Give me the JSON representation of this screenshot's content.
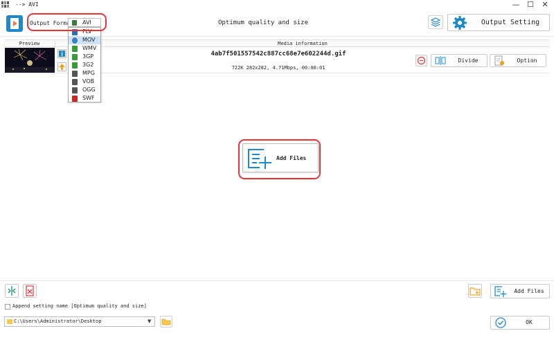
{
  "window": {
    "title": "--> AVI",
    "minimize": "—",
    "maximize": "☐",
    "close": "✕"
  },
  "toolbar": {
    "output_format_label": "Output Format",
    "selected_format": "AVI",
    "center_title": "Optimum quality and size",
    "output_setting_label": "Output Setting"
  },
  "format_dropdown": {
    "options": [
      {
        "label": "FLV",
        "icon": "flv-icon",
        "color": "#2b6fb3"
      },
      {
        "label": "MOV",
        "icon": "mov-icon",
        "color": "#3a7fc1"
      },
      {
        "label": "WMV",
        "icon": "wmv-icon",
        "color": "#3a9a3a"
      },
      {
        "label": "3GP",
        "icon": "3gp-icon",
        "color": "#3a9a3a"
      },
      {
        "label": "3G2",
        "icon": "3g2-icon",
        "color": "#3a9a3a"
      },
      {
        "label": "MPG",
        "icon": "mpg-icon",
        "color": "#555555"
      },
      {
        "label": "VOB",
        "icon": "vob-icon",
        "color": "#555555"
      },
      {
        "label": "OGG",
        "icon": "ogg-icon",
        "color": "#555555"
      },
      {
        "label": "SWF",
        "icon": "swf-icon",
        "color": "#c62828"
      }
    ],
    "highlighted": "MOV"
  },
  "list": {
    "col_preview": "Preview",
    "col_media": "Media information",
    "files": [
      {
        "name": "4ab7f501557542c887cc68e7e602244d.gif",
        "meta": "722K  282x282, 4.71Mbps, 00:00:01"
      }
    ]
  },
  "row_actions": {
    "divide_label": "Divide",
    "option_label": "Option"
  },
  "center": {
    "add_files_label": "Add Files"
  },
  "footer": {
    "add_files_label": "Add Files",
    "append_label": "Append setting name [Optimum quality and size]",
    "path": "C:\\Users\\Administrator\\Desktop",
    "ok_label": "OK"
  },
  "colors": {
    "accent": "#1e88c8",
    "highlight_ring": "#e5343a",
    "orange": "#f0a020"
  }
}
